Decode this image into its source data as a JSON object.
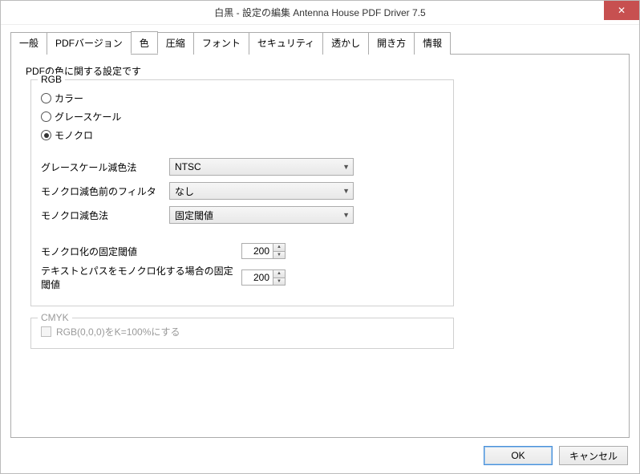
{
  "window": {
    "title": "白黒 - 設定の編集 Antenna House PDF Driver 7.5"
  },
  "tabs": [
    "一般",
    "PDFバージョン",
    "色",
    "圧縮",
    "フォント",
    "セキュリティ",
    "透かし",
    "開き方",
    "情報"
  ],
  "active_tab_index": 2,
  "intro": "PDFの色に関する設定です",
  "rgb": {
    "legend": "RGB",
    "options": [
      "カラー",
      "グレースケール",
      "モノクロ"
    ],
    "selected_index": 2,
    "grayscale_method_label": "グレースケール減色法",
    "grayscale_method_value": "NTSC",
    "mono_prefilter_label": "モノクロ減色前のフィルタ",
    "mono_prefilter_value": "なし",
    "mono_method_label": "モノクロ減色法",
    "mono_method_value": "固定閾値",
    "threshold_label": "モノクロ化の固定閾値",
    "threshold_value": "200",
    "text_path_threshold_label": "テキストとパスをモノクロ化する場合の固定閾値",
    "text_path_threshold_value": "200"
  },
  "cmyk": {
    "legend": "CMYK",
    "rgb_to_k_label": "RGB(0,0,0)をK=100%にする",
    "rgb_to_k_checked": false,
    "enabled": false
  },
  "buttons": {
    "ok": "OK",
    "cancel": "キャンセル"
  }
}
